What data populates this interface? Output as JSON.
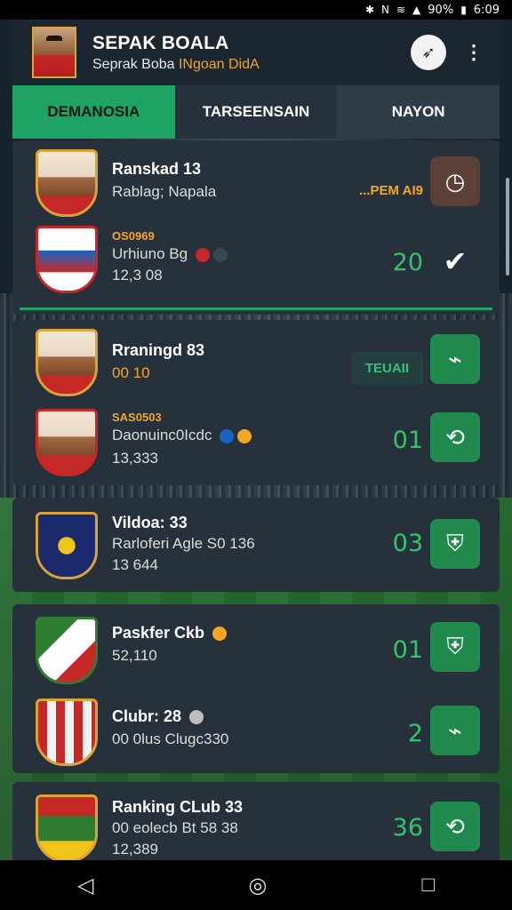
{
  "status_bar": {
    "icons": [
      "bluetooth-icon",
      "nfc-icon",
      "wifi-icon",
      "signal-icon"
    ],
    "battery_text": "90%",
    "time": "6:09"
  },
  "app": {
    "title": "SEPAK BOALA",
    "subtitle_prefix": "Seprak Boba ",
    "subtitle_accent": "INgoan DidA",
    "action_icon": "rocket-icon"
  },
  "tabs": [
    {
      "label": "DEMANOSIA"
    },
    {
      "label": "TARSEENSAIN"
    },
    {
      "label": "NAYON"
    }
  ],
  "cards": [
    {
      "rows": [
        {
          "name": "Ranskad 13",
          "line2": "Rablag; Napala",
          "pill": "...PEM AI9",
          "action_icon": "clock-icon"
        },
        {
          "tag": "OS0969",
          "line2": "Urhiuno Bg",
          "line3": "12,3 08",
          "score": "20",
          "action_icon": "check-icon"
        }
      ]
    },
    {
      "rows": [
        {
          "name": "Rraningd 83",
          "line2": "00 10",
          "pill": "TEUAII",
          "action_icon": "whistle-icon"
        },
        {
          "tag": "SAS0503",
          "line2": "Daonuinc0Icdc",
          "line3": "13,333",
          "score": "01",
          "action_icon": "refresh-icon"
        }
      ]
    },
    {
      "rows": [
        {
          "name": "Vildoa: 33",
          "line2": "Rarloferi Agle S0 136",
          "line3": "13 644",
          "score": "03"
        }
      ]
    },
    {
      "rows": [
        {
          "name": "Paskfer Ckb",
          "line2": "52,110",
          "score": "01"
        },
        {
          "name": "Clubr: 28",
          "line2": "00 0lus Clugc330",
          "score": "2",
          "action_icon": "whistle-icon"
        }
      ]
    },
    {
      "rows": [
        {
          "name": "Ranking CLub 33",
          "line2": "00 eolecb Bt 58 38",
          "line3": "12,389",
          "score": "36",
          "action_icon": "refresh-icon"
        }
      ]
    }
  ],
  "navbar": {
    "back": "◁",
    "home": "◎",
    "recents": "□"
  }
}
